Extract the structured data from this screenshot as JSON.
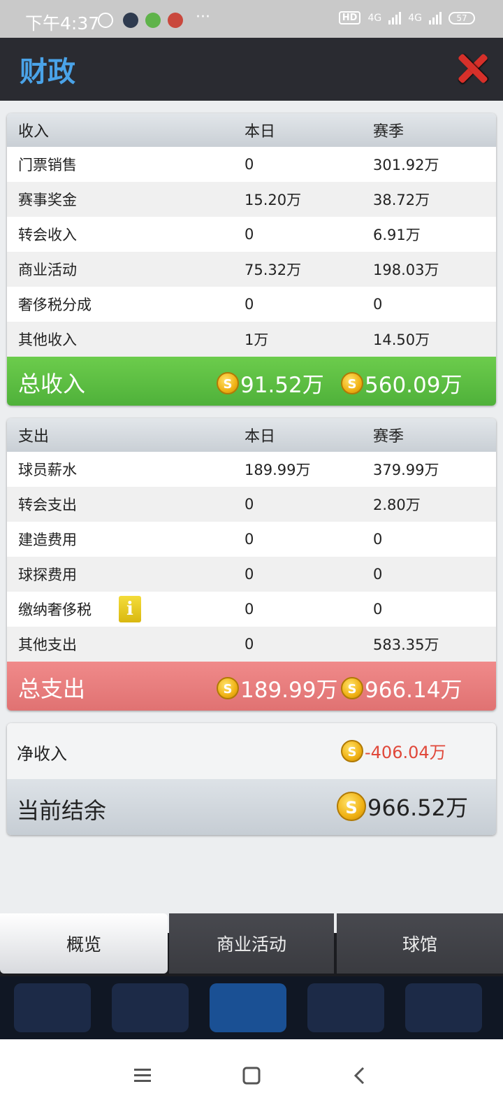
{
  "status": {
    "time": "下午4:37",
    "more": "···",
    "hd": "HD",
    "net1": "4G",
    "net2": "4G",
    "battery": "57"
  },
  "header": {
    "title": "财政"
  },
  "income": {
    "headers": [
      "收入",
      "本日",
      "赛季"
    ],
    "rows": [
      {
        "label": "门票销售",
        "day": "0",
        "season": "301.92万"
      },
      {
        "label": "赛事奖金",
        "day": "15.20万",
        "season": "38.72万"
      },
      {
        "label": "转会收入",
        "day": "0",
        "season": "6.91万"
      },
      {
        "label": "商业活动",
        "day": "75.32万",
        "season": "198.03万"
      },
      {
        "label": "奢侈税分成",
        "day": "0",
        "season": "0"
      },
      {
        "label": "其他收入",
        "day": "1万",
        "season": "14.50万"
      }
    ],
    "total_label": "总收入",
    "total_day": "91.52万",
    "total_season": "560.09万"
  },
  "expense": {
    "headers": [
      "支出",
      "本日",
      "赛季"
    ],
    "rows": [
      {
        "label": "球员薪水",
        "day": "189.99万",
        "season": "379.99万"
      },
      {
        "label": "转会支出",
        "day": "0",
        "season": "2.80万"
      },
      {
        "label": "建造费用",
        "day": "0",
        "season": "0"
      },
      {
        "label": "球探费用",
        "day": "0",
        "season": "0"
      },
      {
        "label": "缴纳奢侈税",
        "day": "0",
        "season": "0"
      },
      {
        "label": "其他支出",
        "day": "0",
        "season": "583.35万"
      }
    ],
    "total_label": "总支出",
    "total_day": "189.99万",
    "total_season": "966.14万"
  },
  "summary": {
    "net_label": "净收入",
    "net_value": "-406.04万",
    "balance_label": "当前结余",
    "balance_value": "966.52万"
  },
  "tabs": [
    {
      "label": "概览"
    },
    {
      "label": "商业活动"
    },
    {
      "label": "球馆"
    }
  ],
  "colors": {
    "accent": "#4aa3e8",
    "income_green": "#5cbd44",
    "expense_red": "#e87a7a",
    "negative": "#e0483a",
    "close_red": "#d6302a"
  },
  "icons": {
    "close": "close-icon",
    "coin": "coin-icon",
    "info": "info-icon"
  }
}
